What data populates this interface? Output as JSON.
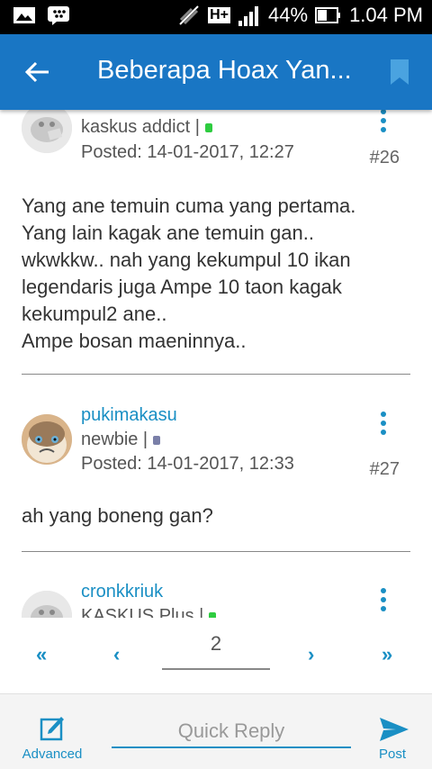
{
  "status_bar": {
    "battery_percent": "44%",
    "time": "1.04 PM",
    "network": "H+"
  },
  "app_bar": {
    "title": "Beberapa Hoax Yan..."
  },
  "posts": [
    {
      "rank": "kaskus addict |",
      "posted": "Posted: 14-01-2017, 12:27",
      "number": "#26",
      "body": "Yang ane temuin cuma yang pertama.\nYang lain kagak ane temuin gan..\nwkwkkw.. nah yang kekumpul 10 ikan\nlegendaris juga Ampe 10 taon kagak\nkekumpul2 ane..\nAmpe bosan maeninnya.."
    },
    {
      "username": "pukimakasu",
      "rank": "newbie |",
      "posted": "Posted: 14-01-2017, 12:33",
      "number": "#27",
      "body": "ah yang boneng gan?"
    },
    {
      "username": "cronkkriuk",
      "rank": "KASKUS Plus |"
    }
  ],
  "pagination": {
    "first": "«",
    "prev": "‹",
    "current_page": "2",
    "next": "›",
    "last": "»"
  },
  "reply_bar": {
    "advanced_label": "Advanced",
    "quick_reply_placeholder": "Quick Reply",
    "post_label": "Post"
  },
  "colors": {
    "app_bar": "#1976c4",
    "accent": "#1a8fc4",
    "online": "#2ecc40",
    "offline": "#7a7fa8"
  }
}
